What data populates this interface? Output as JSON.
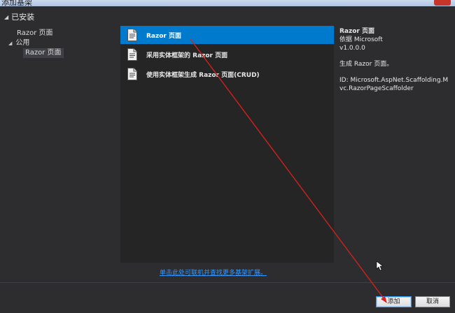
{
  "window": {
    "title": "添加基架"
  },
  "installed": {
    "label": "已安装"
  },
  "tree": {
    "items": [
      {
        "label": "Razor 页面"
      },
      {
        "label": "公用"
      },
      {
        "label": "Razor 页面"
      }
    ]
  },
  "templates": [
    {
      "label": "Razor 页面",
      "icon": "file-icon",
      "selected": true
    },
    {
      "label": "采用实体框架的 Razor 页面",
      "icon": "file-icon",
      "selected": false
    },
    {
      "label": "使用实体框架生成 Razor 页面(CRUD)",
      "icon": "file-icon",
      "selected": false
    }
  ],
  "details": {
    "name": "Razor 页面",
    "author": "依据 Microsoft",
    "version": "v1.0.0.0",
    "description": "生成 Razor 页面。",
    "id": "ID: Microsoft.AspNet.Scaffolding.Mvc.RazorPageScaffolder"
  },
  "online_link": "单击此处可联机并查找更多基架扩展。",
  "buttons": {
    "add": "添加",
    "cancel": "取消"
  },
  "colors": {
    "accent": "#007acc",
    "annotation_arrow": "#d9221c",
    "background": "#2d2d30"
  }
}
